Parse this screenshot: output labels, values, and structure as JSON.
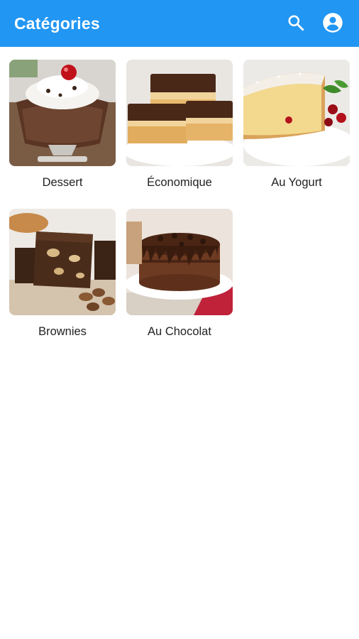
{
  "appbar": {
    "title": "Catégories",
    "icons": [
      "search-icon",
      "account-circle-icon"
    ],
    "color": "#2196f3"
  },
  "categories": [
    {
      "label": "Dessert"
    },
    {
      "label": "Économique"
    },
    {
      "label": "Au Yogurt"
    },
    {
      "label": "Brownies"
    },
    {
      "label": "Au Chocolat"
    }
  ]
}
